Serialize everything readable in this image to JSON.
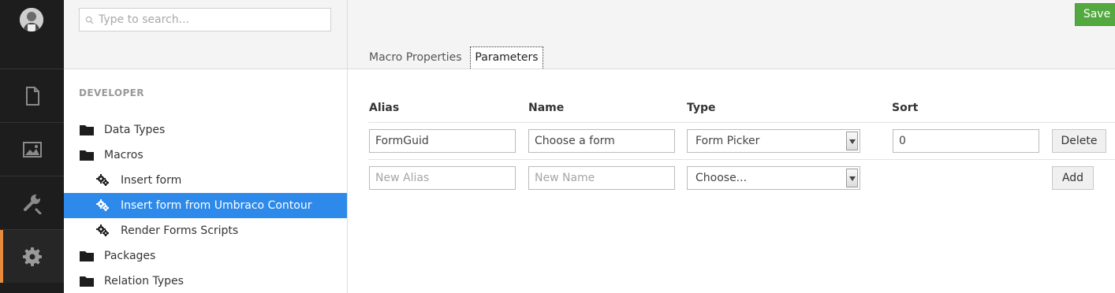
{
  "rail": {
    "avatar": "user-avatar",
    "sections": [
      {
        "icon": "document-icon"
      },
      {
        "icon": "image-icon"
      },
      {
        "icon": "wrench-icon"
      },
      {
        "icon": "gear-icon",
        "active": true
      }
    ],
    "accent": "#e68b3c"
  },
  "tree": {
    "search_placeholder": "Type to search...",
    "section_title": "DEVELOPER",
    "items": [
      {
        "label": "Data Types",
        "icon": "folder-icon",
        "level": 0
      },
      {
        "label": "Macros",
        "icon": "folder-icon",
        "level": 0
      },
      {
        "label": "Insert form",
        "icon": "cogs-icon",
        "level": 1
      },
      {
        "label": "Insert form from Umbraco Contour",
        "icon": "cogs-icon",
        "level": 1,
        "selected": true
      },
      {
        "label": "Render Forms Scripts",
        "icon": "cogs-icon",
        "level": 1
      },
      {
        "label": "Packages",
        "icon": "folder-icon",
        "level": 0
      },
      {
        "label": "Relation Types",
        "icon": "folder-icon",
        "level": 0
      }
    ],
    "selected_color": "#2e8aea"
  },
  "header": {
    "save_label": "Save",
    "save_color": "#53a93f",
    "tabs": [
      {
        "label": "Macro Properties"
      },
      {
        "label": "Parameters",
        "active": true
      }
    ]
  },
  "params": {
    "columns": {
      "alias": "Alias",
      "name": "Name",
      "type": "Type",
      "sort": "Sort"
    },
    "row": {
      "alias": "FormGuid",
      "name": "Choose a form",
      "type": "Form Picker",
      "sort": "0",
      "delete_label": "Delete"
    },
    "new_row": {
      "alias_placeholder": "New Alias",
      "name_placeholder": "New Name",
      "type_placeholder": "Choose...",
      "add_label": "Add"
    }
  }
}
